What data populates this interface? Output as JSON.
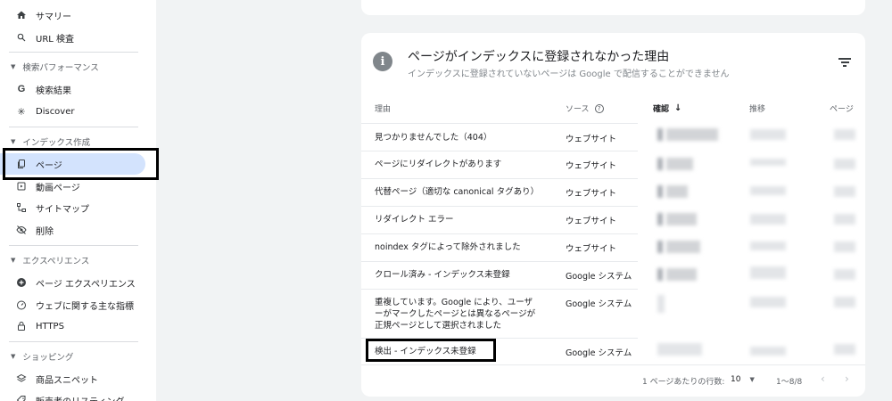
{
  "sidebar": {
    "items_top": [
      {
        "label": "サマリー",
        "icon": "home-icon"
      },
      {
        "label": "URL 検査",
        "icon": "search-icon"
      }
    ],
    "sections": [
      {
        "label": "検索パフォーマンス"
      },
      {
        "label": "インデックス作成"
      },
      {
        "label": "エクスペリエンス"
      },
      {
        "label": "ショッピング"
      }
    ],
    "performance_items": [
      {
        "label": "検索結果",
        "icon": "google-icon"
      },
      {
        "label": "Discover",
        "icon": "asterisk-icon"
      }
    ],
    "indexing_items": [
      {
        "label": "ページ",
        "icon": "pages-icon"
      },
      {
        "label": "動画ページ",
        "icon": "video-page-icon"
      },
      {
        "label": "サイトマップ",
        "icon": "sitemap-icon"
      },
      {
        "label": "削除",
        "icon": "eye-off-icon"
      }
    ],
    "experience_items": [
      {
        "label": "ページ エクスペリエンス",
        "icon": "plus-circle-icon"
      },
      {
        "label": "ウェブに関する主な指標",
        "icon": "speedometer-icon"
      },
      {
        "label": "HTTPS",
        "icon": "lock-icon"
      }
    ],
    "shopping_items": [
      {
        "label": "商品スニペット",
        "icon": "layers-icon"
      },
      {
        "label": "販売者のリスティング",
        "icon": "tag-icon"
      }
    ]
  },
  "card": {
    "title": "ページがインデックスに登録されなかった理由",
    "subtitle": "インデックスに登録されていないページは Google で配信することができません",
    "info_glyph": "i"
  },
  "table": {
    "headers": {
      "reason": "理由",
      "source": "ソース",
      "validation": "確認",
      "trend": "推移",
      "pages": "ページ"
    },
    "rows": [
      {
        "reason": "見つかりませんでした（404）",
        "source": "ウェブサイト"
      },
      {
        "reason": "ページにリダイレクトがあります",
        "source": "ウェブサイト"
      },
      {
        "reason": "代替ページ（適切な canonical タグあり）",
        "source": "ウェブサイト"
      },
      {
        "reason": "リダイレクト エラー",
        "source": "ウェブサイト"
      },
      {
        "reason": "noindex タグによって除外されました",
        "source": "ウェブサイト"
      },
      {
        "reason": "クロール済み - インデックス未登録",
        "source": "Google システム"
      },
      {
        "reason": "重複しています。Google により、ユーザーがマークしたページとは異なるページが正規ページとして選択されました",
        "source": "Google システム"
      },
      {
        "reason": "検出 - インデックス未登録",
        "source": "Google システム"
      }
    ]
  },
  "pagination": {
    "rows_per_page_label": "1 ページあたりの行数:",
    "rows_per_page_value": "10",
    "range": "1〜8/8"
  },
  "colors": {
    "accent": "#d3e3fd",
    "highlight_border": "#000000"
  }
}
